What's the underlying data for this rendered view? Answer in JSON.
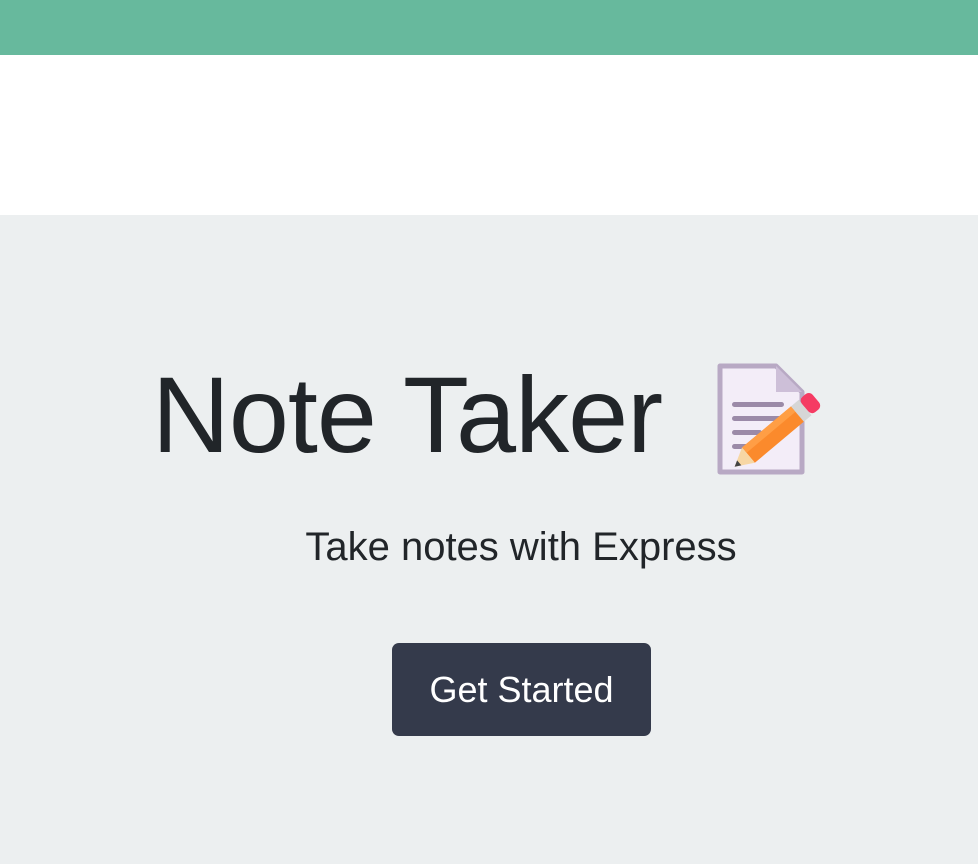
{
  "header": {
    "accent_color": "#67b99d"
  },
  "hero": {
    "title": "Note Taker",
    "title_icon": "memo-pencil-icon",
    "subtitle": "Take notes with Express",
    "cta_label": "Get Started",
    "background_color": "#eceff0",
    "button_color": "#343a4b"
  }
}
